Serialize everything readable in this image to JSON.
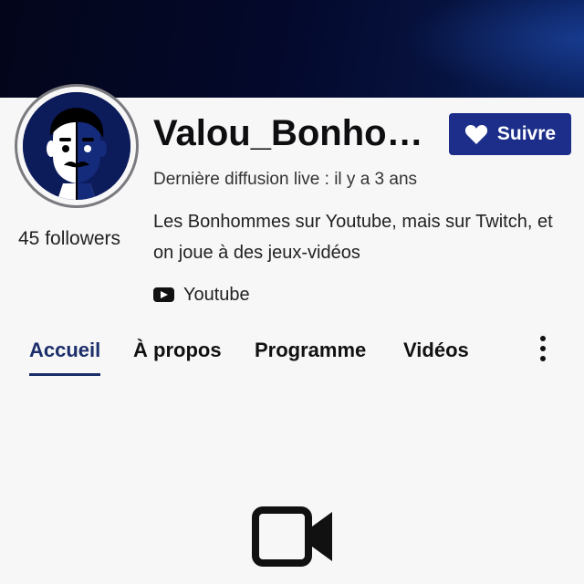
{
  "channel": {
    "name": "Valou_Bonhommes",
    "followers": "45 followers",
    "last_live": "Dernière diffusion live : il y a 3 ans",
    "description": "Les Bonhommes sur Youtube, mais sur Twitch, et on joue à des jeux-vidéos",
    "social_link": "Youtube",
    "avatar_icon": "mascot-face-avatar"
  },
  "follow_button": {
    "label": "Suivre",
    "icon": "heart-icon",
    "color": "#1c2e8a"
  },
  "tabs": [
    {
      "label": "Accueil",
      "active": true
    },
    {
      "label": "À propos",
      "active": false
    },
    {
      "label": "Programme",
      "active": false
    },
    {
      "label": "Vidéos",
      "active": false
    }
  ],
  "more_icon": "more-vertical-icon",
  "empty_state_icon": "video-camera-icon",
  "colors": {
    "accent": "#1c2e8a",
    "tab_active": "#1c2e6a",
    "background": "#f7f7f8",
    "banner": "#04082a"
  }
}
